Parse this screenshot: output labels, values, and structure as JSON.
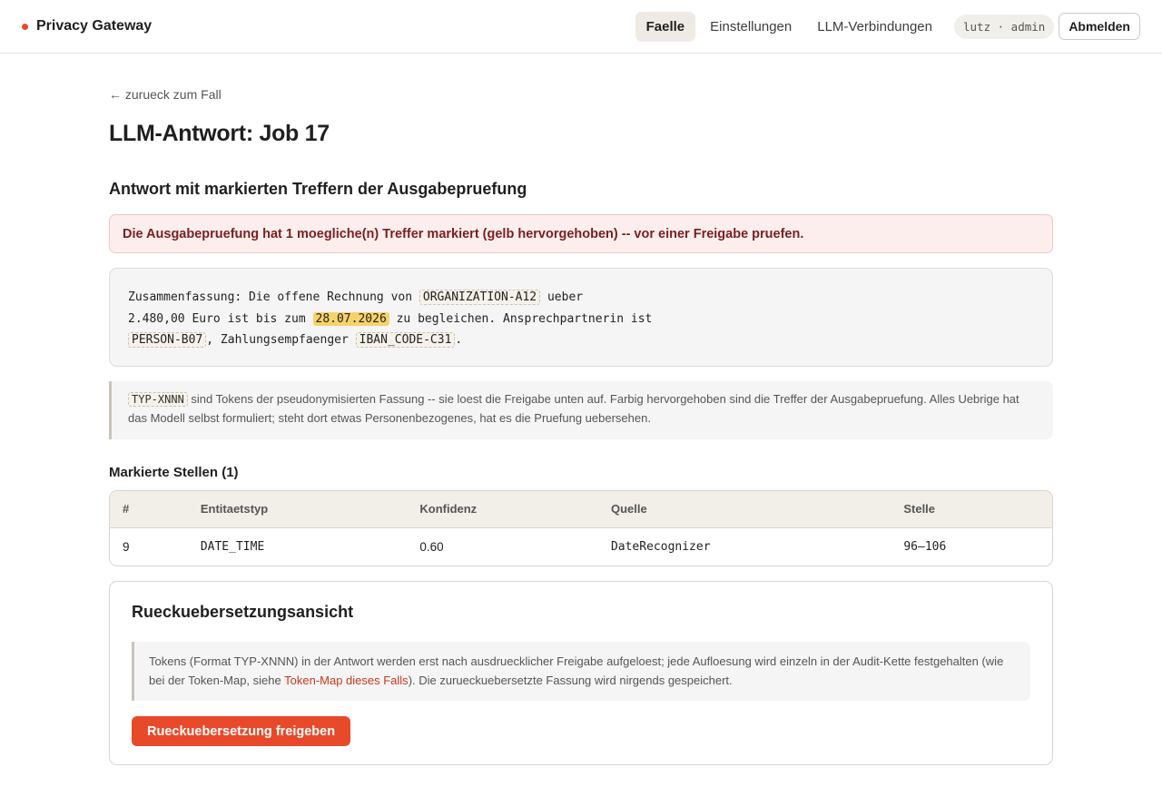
{
  "app": {
    "name": "Privacy Gateway",
    "accent": "#e8492b"
  },
  "nav": {
    "items": [
      {
        "label": "Faelle",
        "active": true
      },
      {
        "label": "Einstellungen",
        "active": false
      },
      {
        "label": "LLM-Verbindungen",
        "active": false
      }
    ],
    "user": "lutz · admin",
    "logout_label": "Abmelden"
  },
  "page": {
    "back_link": "← zurueck zum Fall",
    "title": "LLM-Antwort: Job 17",
    "section_title": "Antwort mit markierten Treffern der Ausgabepruefung",
    "alert": "Die Ausgabepruefung hat 1 moegliche(n) Treffer markiert (gelb hervorgehoben) -- vor einer Freigabe pruefen."
  },
  "answer": {
    "t1": "Zusammenfassung: Die offene Rechnung von ",
    "tok1": "ORGANIZATION-A12",
    "t2": " ueber",
    "t3": "2.480,00 Euro ist bis zum ",
    "hit1": "28.07.2026",
    "t4": " zu begleichen. Ansprechpartnerin ist",
    "tok2": "PERSON-B07",
    "t5": ", Zahlungsempfaenger ",
    "tok3": "IBAN_CODE-C31",
    "t6": "."
  },
  "note": {
    "token": "TYP-XNNN",
    "text": " sind Tokens der pseudonymisierten Fassung -- sie loest die Freigabe unten auf. Farbig hervorgehoben sind die Treffer der Ausgabepruefung. Alles Uebrige hat das Modell selbst formuliert; steht dort etwas Personenbezogenes, hat es die Pruefung uebersehen."
  },
  "marked": {
    "title": "Markierte Stellen (1)",
    "columns": [
      "#",
      "Entitaetstyp",
      "Konfidenz",
      "Quelle",
      "Stelle"
    ],
    "rows": [
      {
        "id": "9",
        "type": "DATE_TIME",
        "confidence": "0.60",
        "source": "DateRecognizer",
        "span": "96–106"
      }
    ]
  },
  "translation": {
    "title": "Rueckuebersetzungsansicht",
    "note_before": "Tokens (Format TYP-XNNN) in der Antwort werden erst nach ausdruecklicher Freigabe aufgeloest; jede Aufloesung wird einzeln in der Audit-Kette festgehalten (wie bei der Token-Map, siehe ",
    "note_link": "Token-Map dieses Falls",
    "note_after": "). Die zurueckuebersetzte Fassung wird nirgends gespeichert.",
    "button_label": "Rueckuebersetzung freigeben"
  }
}
